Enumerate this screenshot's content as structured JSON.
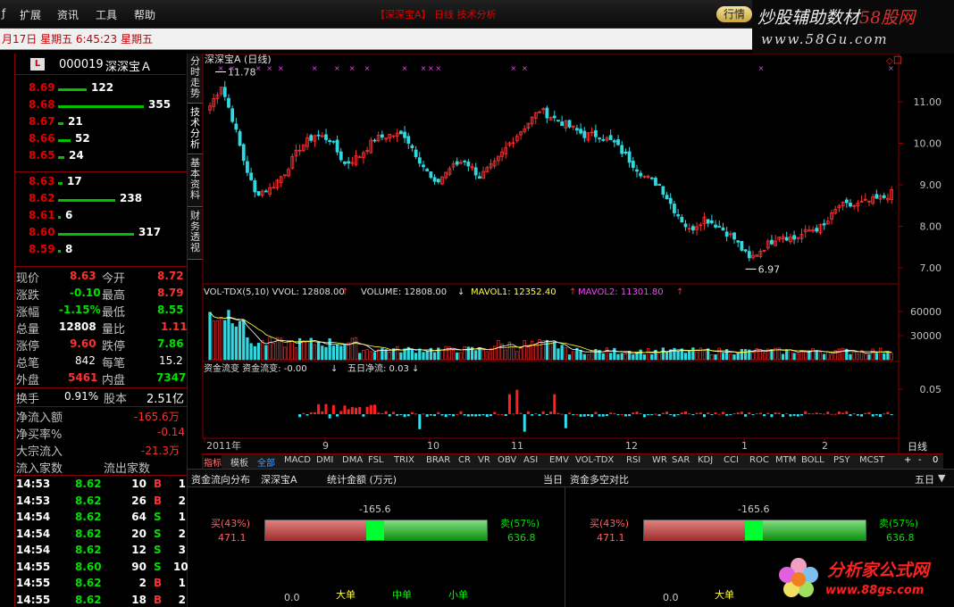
{
  "menu": {
    "items": [
      "扩展",
      "资讯",
      "工具",
      "帮助"
    ],
    "title": "【深深宝A】 日线  技术分析",
    "quote_button": "行情"
  },
  "brand": {
    "top_title_a": "炒股辅助数材",
    "top_title_b": "58股网",
    "top_url": "www.58Gu.com",
    "bottom_title": "分析家公式网",
    "bottom_url": "www.88gs.com"
  },
  "infobar": {
    "text": "月17日  星期五  6:45:23 星期五"
  },
  "stock": {
    "badge": "L",
    "code": "000019",
    "name": "深深宝Ａ"
  },
  "sell_orders": [
    {
      "price": "8.69",
      "vol": "122",
      "w": 0.33
    },
    {
      "price": "8.68",
      "vol": "355",
      "w": 1.0
    },
    {
      "price": "8.67",
      "vol": "21",
      "w": 0.06
    },
    {
      "price": "8.66",
      "vol": "52",
      "w": 0.15
    },
    {
      "price": "8.65",
      "vol": "24",
      "w": 0.07
    }
  ],
  "buy_orders": [
    {
      "price": "8.63",
      "vol": "17",
      "w": 0.05
    },
    {
      "price": "8.62",
      "vol": "238",
      "w": 0.67
    },
    {
      "price": "8.61",
      "vol": "6",
      "w": 0.02
    },
    {
      "price": "8.60",
      "vol": "317",
      "w": 0.89
    },
    {
      "price": "8.59",
      "vol": "8",
      "w": 0.02
    }
  ],
  "quote": {
    "now_l": "现价",
    "now": "8.63",
    "open_l": "今开",
    "open": "8.72",
    "chg_l": "涨跌",
    "chg": "-0.10",
    "high_l": "最高",
    "high": "8.79",
    "pct_l": "涨幅",
    "pct": "-1.15%",
    "low_l": "最低",
    "low": "8.55",
    "vol_l": "总量",
    "vol": "12808",
    "ratio_l": "量比",
    "ratio": "1.11",
    "up_l": "涨停",
    "up": "9.60",
    "dn_l": "跌停",
    "dn": "7.86",
    "cnt_l": "总笔",
    "cnt": "842",
    "per_l": "每笔",
    "per": "15.2",
    "out_l": "外盘",
    "out": "5461",
    "in_l": "内盘",
    "in": "7347",
    "turn_l": "换手",
    "turn": "0.91%",
    "cap_l": "股本",
    "cap": "2.51亿",
    "netin_l": "净流入额",
    "netin": "-165.6万",
    "netbuy_l": "净买率%",
    "netbuy": "-0.14",
    "block_l": "大宗流入",
    "block": "-21.3万",
    "infl_l": "流入家数",
    "outfl_l": "流出家数"
  },
  "ticks": [
    {
      "t": "14:53",
      "p": "8.62",
      "v": "10",
      "s": "B",
      "n": "1"
    },
    {
      "t": "14:53",
      "p": "8.62",
      "v": "26",
      "s": "B",
      "n": "2"
    },
    {
      "t": "14:54",
      "p": "8.62",
      "v": "64",
      "s": "S",
      "n": "1"
    },
    {
      "t": "14:54",
      "p": "8.62",
      "v": "20",
      "s": "S",
      "n": "2"
    },
    {
      "t": "14:54",
      "p": "8.62",
      "v": "12",
      "s": "S",
      "n": "3"
    },
    {
      "t": "14:55",
      "p": "8.60",
      "v": "90",
      "s": "S",
      "n": "10"
    },
    {
      "t": "14:55",
      "p": "8.62",
      "v": "2",
      "s": "B",
      "n": "1"
    },
    {
      "t": "14:55",
      "p": "8.62",
      "v": "18",
      "s": "B",
      "n": "2"
    }
  ],
  "side_tabs": [
    "分时走势",
    "技术分析",
    "基本资料",
    "财务透视"
  ],
  "main_chart": {
    "label": "深深宝A (日线)",
    "hi_label": "11.78",
    "lo_label": "6.97",
    "price_ticks": [
      "11.00",
      "10.00",
      "9.00",
      "8.00",
      "7.00"
    ]
  },
  "vol_chart": {
    "label1": "VOL-TDX(5,10)  VVOL: 12808.00",
    "label2": "VOLUME: 12808.00",
    "label3": "MAVOL1: 12352.40",
    "label4": "MAVOL2: 11301.80",
    "ticks": [
      "60000",
      "30000"
    ]
  },
  "flow_chart": {
    "label1": "资金流变  资金流变: -0.00",
    "label2": "五日净流: 0.03",
    "tick": "0.05"
  },
  "time_axis": {
    "labels": [
      "2011年",
      "9",
      "10",
      "11",
      "12",
      "1",
      "2"
    ],
    "period": "日线"
  },
  "indicator_tabs": [
    "指标",
    "模板",
    "全部",
    "MACD",
    "DMI",
    "DMA",
    "FSL",
    "TRIX",
    "BRAR",
    "CR",
    "VR",
    "OBV",
    "ASI",
    "EMV",
    "VOL-TDX",
    "RSI",
    "WR",
    "SAR",
    "KDJ",
    "CCI",
    "ROC",
    "MTM",
    "BOLL",
    "PSY",
    "MCST"
  ],
  "indicator_controls": [
    "+",
    "-",
    "0"
  ],
  "bottom": {
    "h1": "资金流向分布",
    "h2": "深深宝A",
    "h3": "统计金额 (万元)",
    "h4": "当日",
    "h5": "资金多空对比",
    "h6": "五日",
    "left": {
      "net": "-165.6",
      "buy_l": "买(43%)",
      "buy_v": "471.1",
      "sell_l": "卖(57%)",
      "sell_v": "636.8",
      "buy_frac": 0.43
    },
    "right": {
      "net": "-165.6",
      "buy_l": "买(43%)",
      "buy_v": "471.1",
      "sell_l": "卖(57%)",
      "sell_v": "636.8",
      "buy_frac": 0.43
    },
    "zero": "0.0",
    "cats": [
      "大单",
      "中单",
      "小单"
    ]
  },
  "colors": {
    "up": "#ff3030",
    "down": "#00c8c8",
    "bg": "#000000"
  }
}
